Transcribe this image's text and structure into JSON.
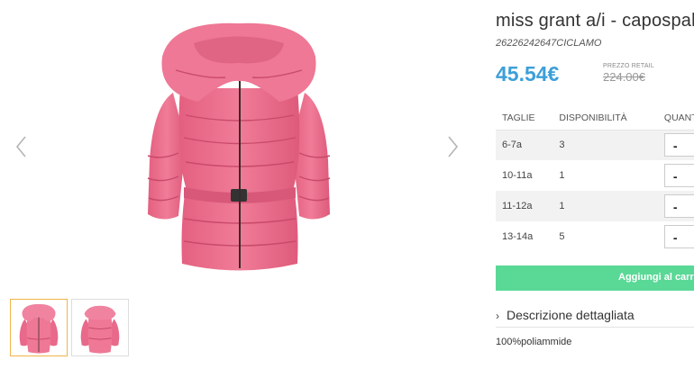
{
  "product": {
    "title": "miss grant a/i - capospalla",
    "sku": "26226242647CICLAMO",
    "price": "45.54€",
    "retail_label": "PREZZO RETAIL",
    "retail_price": "224.00€"
  },
  "gallery": {
    "prev_icon": "chevron-left-icon",
    "next_icon": "chevron-right-icon",
    "thumbnails": [
      "front-view",
      "back-view"
    ],
    "active_thumbnail": 0,
    "jacket_color": "#ea6d8c"
  },
  "sizes": {
    "headers": [
      "TAGLIE",
      "DISPONIBILITÀ",
      "QUANTITÀ"
    ],
    "rows": [
      {
        "size": "6-7a",
        "availability": "3",
        "qty_symbol": "-"
      },
      {
        "size": "10-11a",
        "availability": "1",
        "qty_symbol": "-"
      },
      {
        "size": "11-12a",
        "availability": "1",
        "qty_symbol": "-"
      },
      {
        "size": "13-14a",
        "availability": "5",
        "qty_symbol": "-"
      }
    ]
  },
  "cart": {
    "add_label": "Aggiungi al carrello",
    "button_color": "#5ad896"
  },
  "description": {
    "toggle_label": "Descrizione dettagliata",
    "chevron": "›",
    "text": "100%poliammide"
  },
  "colors": {
    "price": "#3d9fd9",
    "active_thumb_border": "#f0b44a"
  }
}
